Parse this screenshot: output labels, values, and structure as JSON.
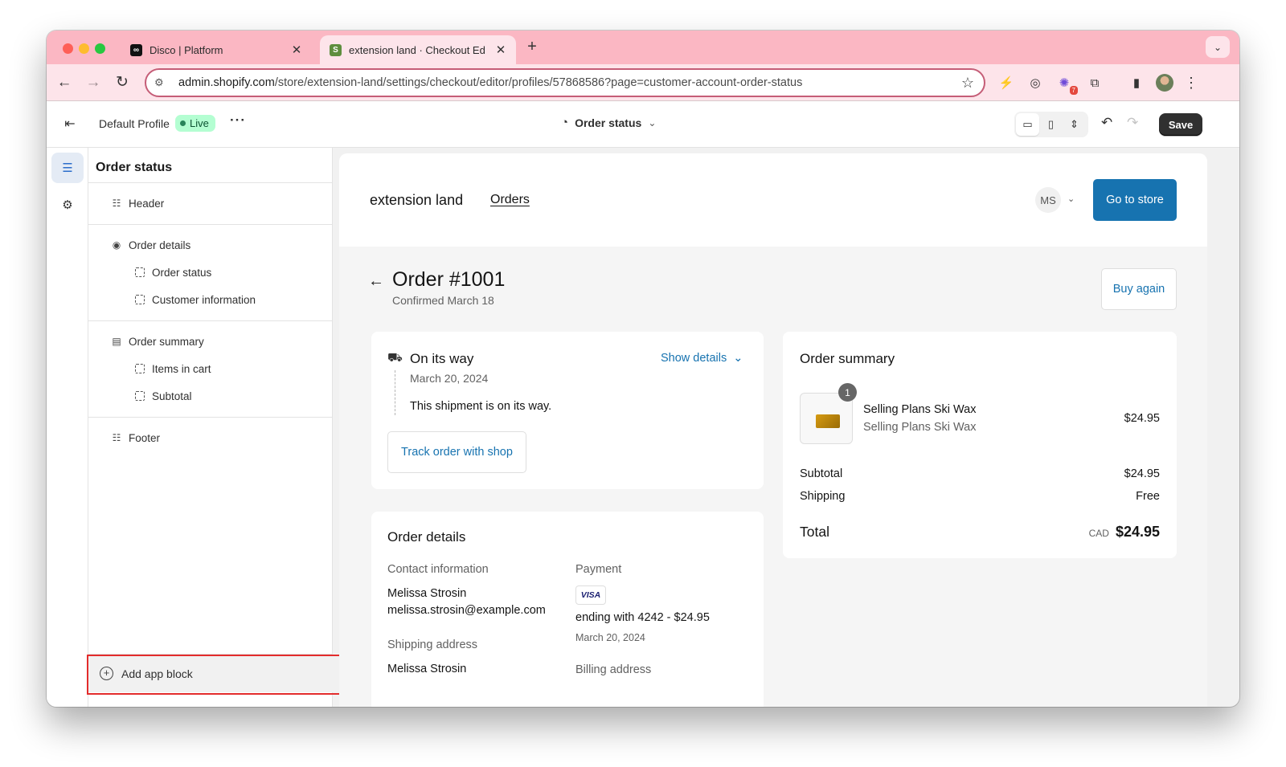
{
  "browser": {
    "tabs": [
      {
        "title": "Disco | Platform",
        "favicon": "disco-favicon"
      },
      {
        "title": "extension land · Checkout Ed",
        "favicon": "shopify-favicon"
      }
    ],
    "url_host": "admin.shopify.com",
    "url_path": "/store/extension-land/settings/checkout/editor/profiles/57868586?page=customer-account-order-status",
    "extension_badge": "7"
  },
  "editor": {
    "profile_name": "Default Profile",
    "live_label": "Live",
    "page_select_label": "Order status",
    "save_label": "Save"
  },
  "sidebar": {
    "title": "Order status",
    "groups": [
      {
        "label": "Header",
        "children": []
      },
      {
        "label": "Order details",
        "children": [
          {
            "label": "Order status"
          },
          {
            "label": "Customer information"
          }
        ]
      },
      {
        "label": "Order summary",
        "children": [
          {
            "label": "Items in cart"
          },
          {
            "label": "Subtotal"
          }
        ]
      },
      {
        "label": "Footer",
        "children": []
      }
    ],
    "add_app_block_label": "Add app block"
  },
  "preview": {
    "store_name": "extension land",
    "nav_orders": "Orders",
    "account_initials": "MS",
    "go_to_store": "Go to store",
    "order_title": "Order #1001",
    "order_confirmed": "Confirmed March 18",
    "buy_again": "Buy again",
    "shipment": {
      "status": "On its way",
      "date": "March 20, 2024",
      "message": "This shipment is on its way.",
      "show_details": "Show details",
      "track_button": "Track order with shop"
    },
    "summary": {
      "title": "Order summary",
      "item": {
        "quantity": "1",
        "name": "Selling Plans Ski Wax",
        "variant": "Selling Plans Ski Wax",
        "price": "$24.95"
      },
      "subtotal_label": "Subtotal",
      "subtotal_value": "$24.95",
      "shipping_label": "Shipping",
      "shipping_value": "Free",
      "total_label": "Total",
      "total_currency": "CAD",
      "total_value": "$24.95"
    },
    "details": {
      "title": "Order details",
      "contact_label": "Contact information",
      "contact_name": "Melissa Strosin",
      "contact_email": "melissa.strosin@example.com",
      "payment_label": "Payment",
      "card_brand": "VISA",
      "payment_text": "ending with 4242 - $24.95",
      "payment_date": "March 20, 2024",
      "shipping_address_label": "Shipping address",
      "shipping_name": "Melissa Strosin",
      "billing_address_label": "Billing address"
    }
  },
  "colors": {
    "accent_blue": "#1773b0",
    "highlight_red": "#e32c2c",
    "tab_strip_pink": "#fbb7c3",
    "live_green": "#b4fed2"
  }
}
